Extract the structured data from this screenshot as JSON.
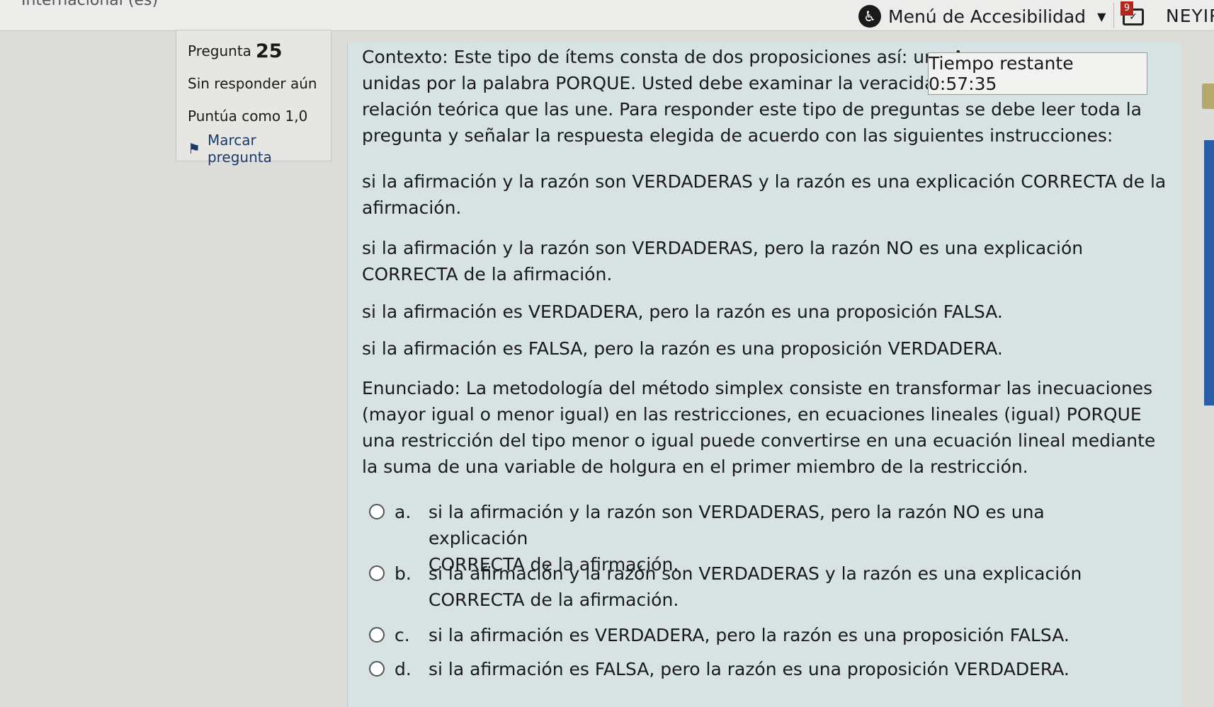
{
  "topbar": {
    "language": "Internacional (es)",
    "accessibility_label": "Menú de Accesibilidad",
    "notifications_count": "9",
    "user_name": "NEYIR"
  },
  "question_info": {
    "label": "Pregunta",
    "number": "25",
    "status": "Sin responder aún",
    "score": "Puntúa como 1,0",
    "flag_label": "Marcar pregunta"
  },
  "timer": {
    "text": "Tiempo restante 0:57:35"
  },
  "question": {
    "context_lines": [
      "Contexto: Este tipo de ítems consta de dos proposiciones así: una A",
      "unidas por la palabra PORQUE. Usted debe examinar la veracidad d",
      "relación teórica que las une. Para responder este tipo de preguntas se debe leer toda la",
      "pregunta y señalar la respuesta elegida de acuerdo con las siguientes instrucciones:"
    ],
    "instructions": [
      [
        "si la afirmación y la razón son VERDADERAS y la razón es una explicación CORRECTA de la",
        "afirmación."
      ],
      [
        "si la afirmación y la razón son VERDADERAS, pero la razón NO es una explicación",
        "CORRECTA de la afirmación."
      ],
      [
        "si la afirmación es VERDADERA, pero la razón es una proposición FALSA."
      ],
      [
        "si la afirmación es FALSA, pero la razón es una proposición VERDADERA."
      ]
    ],
    "statement_lines": [
      "Enunciado: La metodología del método simplex consiste en transformar las inecuaciones",
      "(mayor igual o menor igual) en las restricciones, en ecuaciones lineales (igual) PORQUE",
      "una restricción del tipo menor o igual puede convertirse en una ecuación lineal mediante",
      "la suma de una variable de holgura en el primer miembro de la restricción."
    ]
  },
  "options": [
    {
      "letter": "a.",
      "lines": [
        "si la afirmación y la razón son VERDADERAS, pero la razón NO es una explicación",
        "CORRECTA de la afirmación."
      ]
    },
    {
      "letter": "b.",
      "lines": [
        "si la afirmación y la razón son VERDADERAS y la razón es una explicación",
        "CORRECTA de la afirmación."
      ]
    },
    {
      "letter": "c.",
      "lines": [
        "si la afirmación es VERDADERA, pero la razón es una proposición FALSA."
      ]
    },
    {
      "letter": "d.",
      "lines": [
        "si la afirmación es FALSA, pero la razón es una proposición VERDADERA."
      ]
    }
  ]
}
